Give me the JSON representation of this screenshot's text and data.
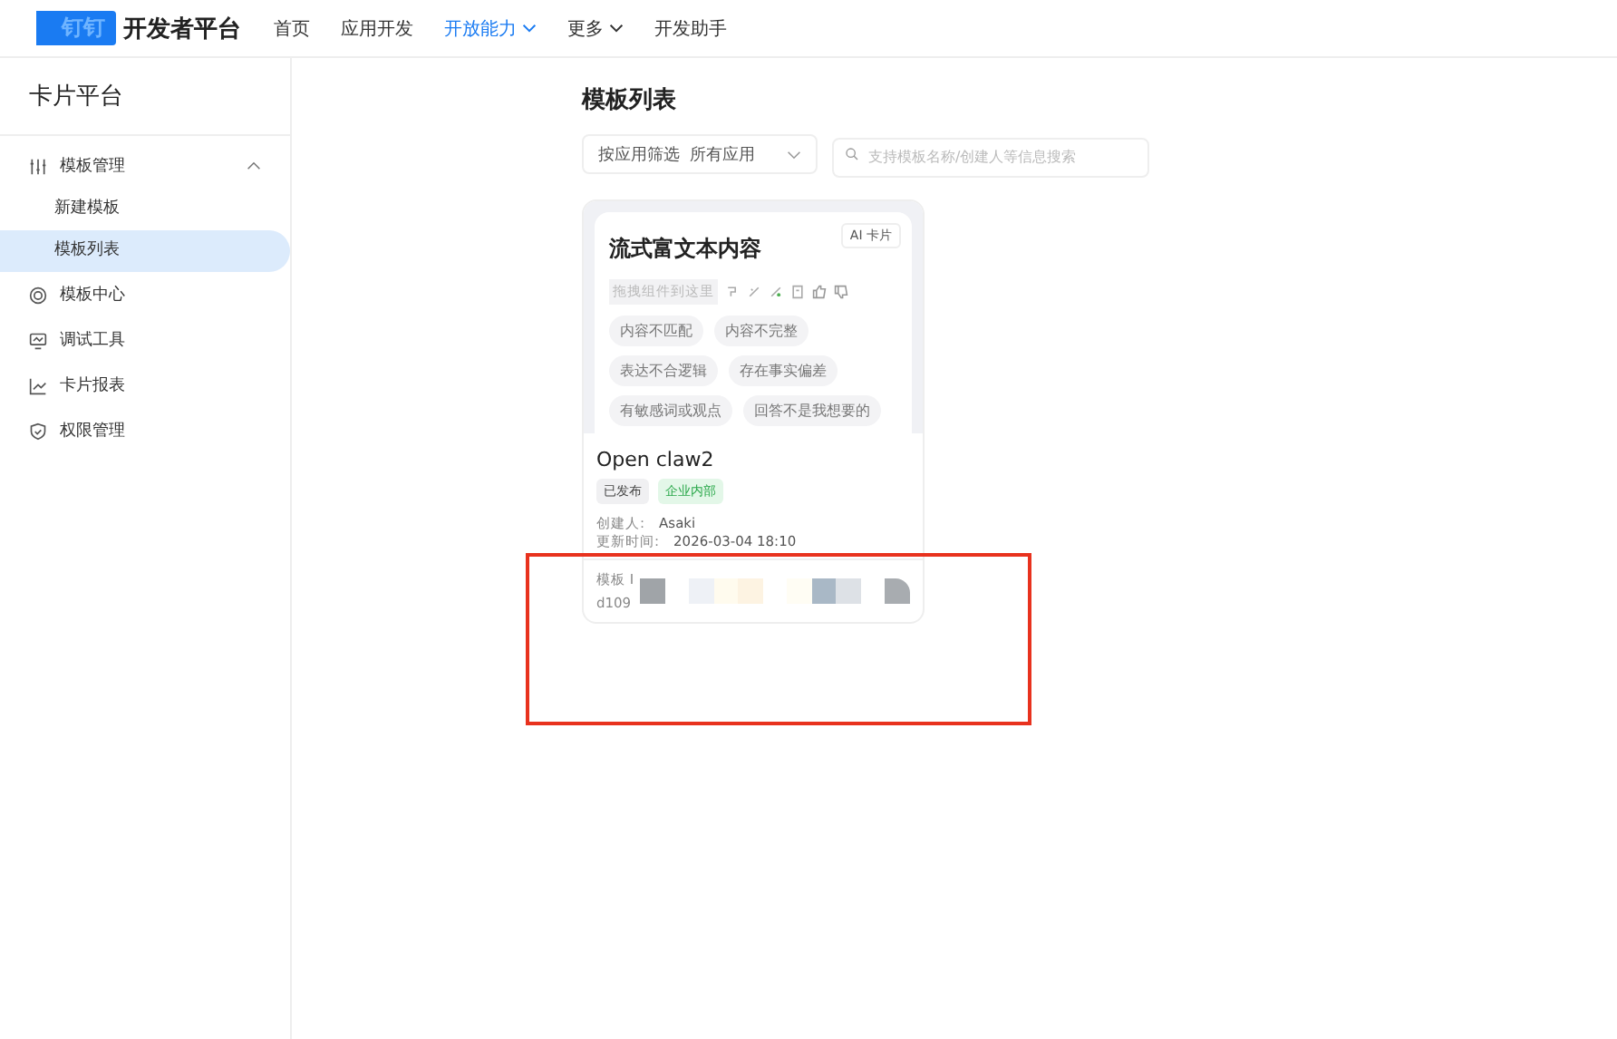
{
  "nav": {
    "logo": "钉钉",
    "title": "开发者平台",
    "items": [
      {
        "label": "首页",
        "selected": false,
        "dropdown": false
      },
      {
        "label": "应用开发",
        "selected": false,
        "dropdown": false
      },
      {
        "label": "开放能力",
        "selected": true,
        "dropdown": true
      },
      {
        "label": "更多",
        "selected": false,
        "dropdown": true
      },
      {
        "label": "开发助手",
        "selected": false,
        "dropdown": false
      }
    ]
  },
  "sidebar": {
    "title": "卡片平台",
    "items": [
      {
        "label": "模板管理",
        "expanded": true,
        "children": [
          {
            "label": "新建模板",
            "selected": false
          },
          {
            "label": "模板列表",
            "selected": true
          }
        ]
      },
      {
        "label": "模板中心"
      },
      {
        "label": "调试工具"
      },
      {
        "label": "卡片报表"
      },
      {
        "label": "权限管理"
      }
    ]
  },
  "page": {
    "title": "模板列表",
    "filter": {
      "label": "按应用筛选",
      "value": "所有应用"
    },
    "search": {
      "placeholder": "支持模板名称/创建人等信息搜索"
    }
  },
  "cards": [
    {
      "preview": {
        "badge": "AI 卡片",
        "heading": "流式富文本内容",
        "drop_hint": "拖拽组件到这里",
        "tags": [
          "内容不匹配",
          "内容不完整",
          "表达不合逻辑",
          "存在事实偏差",
          "有敏感词或观点",
          "回答不是我想要的"
        ]
      },
      "name": "Open claw2",
      "tags": [
        {
          "label": "已发布",
          "kind": "neutral"
        },
        {
          "label": "企业内部",
          "kind": "green"
        }
      ],
      "fields": [
        {
          "label": "创建人:",
          "value": "Asaki"
        },
        {
          "label": "更新时间:",
          "value": "2026-03-04 18:10"
        }
      ],
      "id_label": "模板 I",
      "id_value": "d109"
    }
  ],
  "annotation": {
    "kind": "highlight"
  }
}
